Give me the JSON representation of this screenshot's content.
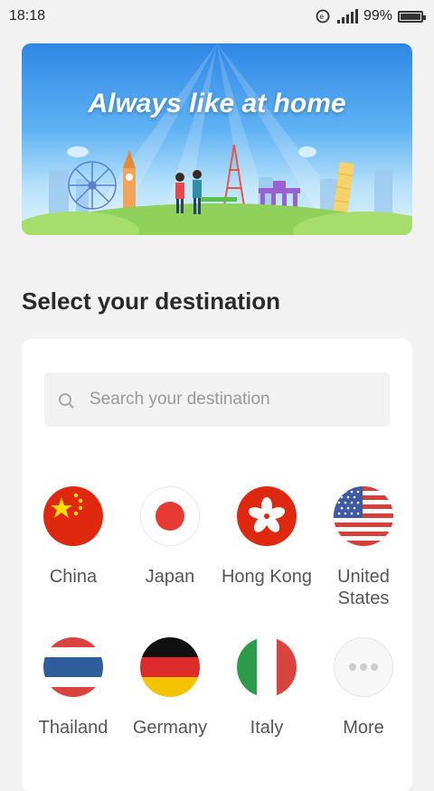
{
  "status_bar": {
    "time": "18:18",
    "battery": "99%",
    "battery_level": 0.99
  },
  "banner": {
    "title": "Always like at home"
  },
  "section": {
    "title": "Select your destination"
  },
  "search": {
    "placeholder": "Search your destination",
    "value": ""
  },
  "destinations": [
    {
      "label": "China",
      "icon": "china-flag-icon"
    },
    {
      "label": "Japan",
      "icon": "japan-flag-icon"
    },
    {
      "label": "Hong Kong",
      "icon": "hong-kong-flag-icon"
    },
    {
      "label": "United States",
      "icon": "us-flag-icon"
    },
    {
      "label": "Thailand",
      "icon": "thailand-flag-icon"
    },
    {
      "label": "Germany",
      "icon": "germany-flag-icon"
    },
    {
      "label": "Italy",
      "icon": "italy-flag-icon"
    },
    {
      "label": "More",
      "icon": "more-icon"
    }
  ],
  "colors": {
    "china_red": "#de2910",
    "japan_red": "#e63a32",
    "hk_red": "#de2910",
    "us_red": "#d6403a",
    "us_blue": "#3c5aa6",
    "thai_blue": "#2f5d9c",
    "thai_red": "#d9443f",
    "germany_black": "#111111",
    "germany_red": "#dd2a2a",
    "germany_gold": "#f5c400",
    "italy_green": "#2c9b4a",
    "italy_red": "#d9443f"
  }
}
